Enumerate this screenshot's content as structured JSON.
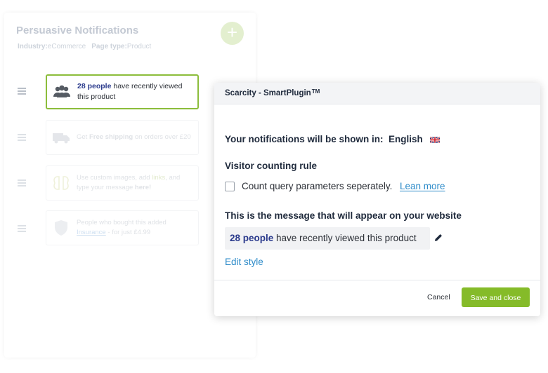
{
  "background": {
    "title": "Persuasive Notifications",
    "industry_label": "Industry:",
    "industry_value": "eCommerce",
    "pagetype_label": "Page type:",
    "pagetype_value": "Product",
    "add_symbol": "+",
    "cards": [
      {
        "icon": "people-icon",
        "highlight": "28 people",
        "text": " have recently viewed this product"
      },
      {
        "icon": "truck-icon",
        "pre": "Get ",
        "bold": "Free shipping",
        "post": " on orders over £20"
      },
      {
        "icon": "brain-icon",
        "pre": "Use custom images, add ",
        "link": "links",
        "mid": ", and type your message ",
        "bold": "here!"
      },
      {
        "icon": "shield-icon",
        "pre": "People who bought this added ",
        "link": "Insurance",
        "post": " - for just £4.99"
      }
    ]
  },
  "modal": {
    "title": "Scarcity - SmartPlugin",
    "title_sup": "TM",
    "language_prefix": "Your notifications will be shown in:",
    "language_value": "English",
    "language_flag": "uk-flag-icon",
    "visitor_rule_title": "Visitor counting rule",
    "checkbox_label": "Count query parameters seperately.",
    "checkbox_checked": false,
    "learn_more": "Lean more",
    "message_title": "This is the message that will appear on your website",
    "message_highlight": "28 people",
    "message_rest": " have recently viewed this product",
    "edit_style": "Edit style",
    "cancel": "Cancel",
    "save": "Save and close"
  },
  "colors": {
    "accent_green": "#85bb29",
    "link_blue": "#2d8bc9",
    "highlight_navy": "#2a3a8c"
  }
}
